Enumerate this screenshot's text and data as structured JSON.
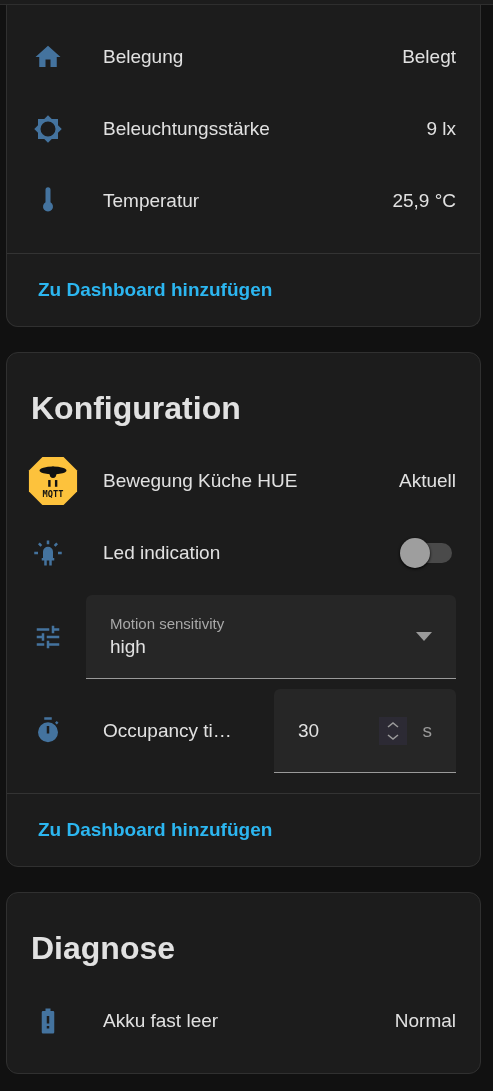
{
  "sections": [
    {
      "rows": [
        {
          "kind": "state",
          "label": "Belegung",
          "value": "Belegt"
        },
        {
          "kind": "state",
          "label": "Beleuchtungsstärke",
          "value": "9 lx"
        },
        {
          "kind": "state",
          "label": "Temperatur",
          "value": "25,9 °C"
        }
      ],
      "link": "Zu Dashboard hinzufügen"
    },
    {
      "title": "Konfiguration",
      "rows": [
        {
          "kind": "device",
          "label": "Bewegung Küche HUE",
          "value": "Aktuell",
          "logo_text": "MQTT"
        },
        {
          "kind": "toggle",
          "label": "Led indication",
          "on": false
        },
        {
          "kind": "select",
          "label": "Motion sensitivity",
          "value": "high"
        },
        {
          "kind": "number",
          "label": "Occupancy ti…",
          "value": "30",
          "unit": "s"
        }
      ],
      "link": "Zu Dashboard hinzufügen"
    },
    {
      "title": "Diagnose",
      "rows": [
        {
          "kind": "state",
          "label": "Akku fast leer",
          "value": "Normal"
        }
      ]
    }
  ]
}
